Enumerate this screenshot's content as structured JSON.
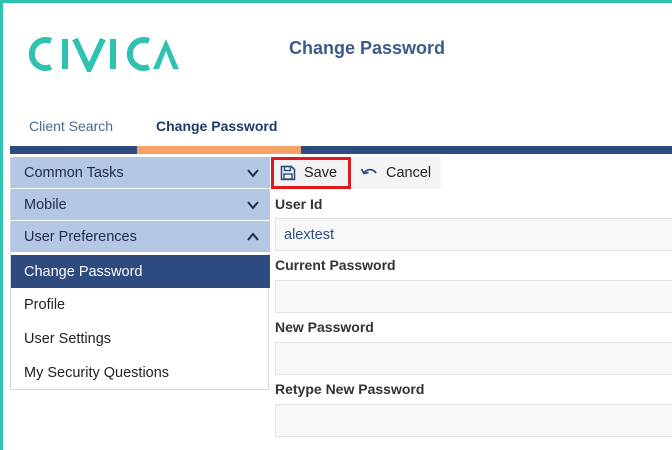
{
  "brand": {
    "name": "CIVICA",
    "color": "#2fc2b0"
  },
  "header": {
    "title": "Change Password"
  },
  "tabs": [
    {
      "label": "Client Search",
      "active": false
    },
    {
      "label": "Change Password",
      "active": true
    }
  ],
  "sidebar": {
    "sections": [
      {
        "label": "Common Tasks",
        "expanded": false,
        "icon": "chevron-down-icon"
      },
      {
        "label": "Mobile",
        "expanded": false,
        "icon": "chevron-down-icon"
      },
      {
        "label": "User Preferences",
        "expanded": true,
        "icon": "chevron-up-icon"
      }
    ],
    "items": [
      {
        "label": "Change Password",
        "active": true
      },
      {
        "label": "Profile",
        "active": false
      },
      {
        "label": "User Settings",
        "active": false
      },
      {
        "label": "My Security Questions",
        "active": false
      }
    ]
  },
  "toolbar": {
    "save_label": "Save",
    "save_icon": "floppy-disk-icon",
    "cancel_label": "Cancel",
    "cancel_icon": "undo-arrow-icon"
  },
  "form": {
    "user_id": {
      "label": "User Id",
      "value": "alextest"
    },
    "current_password": {
      "label": "Current Password",
      "value": ""
    },
    "new_password": {
      "label": "New Password",
      "value": ""
    },
    "retype_password": {
      "label": "Retype New Password",
      "value": ""
    }
  },
  "colors": {
    "nav_bar": "#2d4b7e",
    "active_tab_accent": "#f4a26a",
    "sidebar_section": "#b4c8e6",
    "highlight_border": "#e0191f"
  }
}
